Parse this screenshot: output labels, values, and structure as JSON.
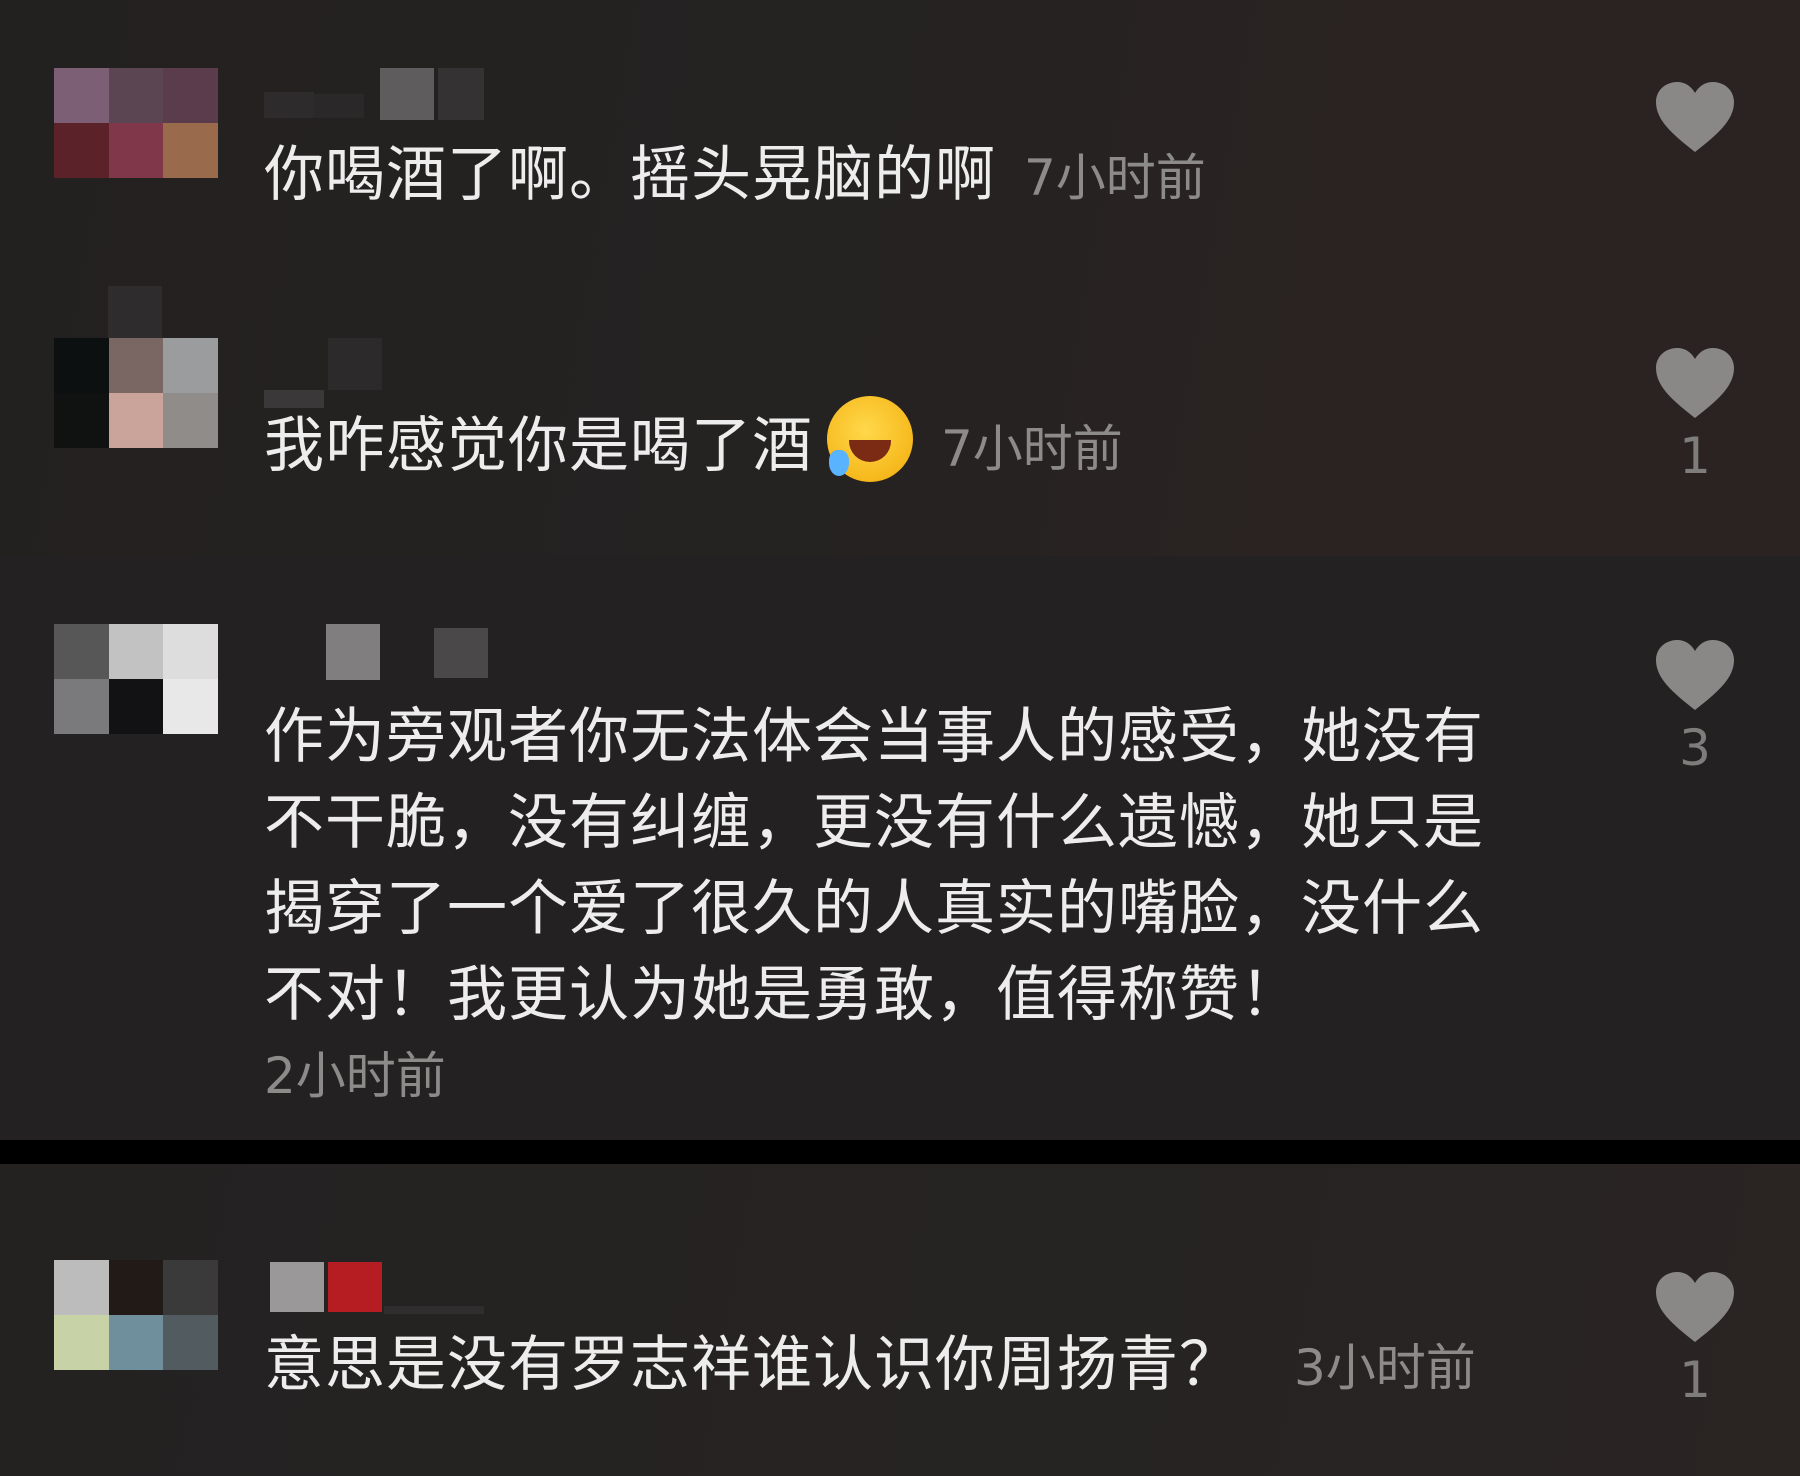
{
  "colors": {
    "background": "#232121",
    "text": "#ededed",
    "timestamp": "#8d8b8a",
    "like_icon": "#8a8887"
  },
  "comments": [
    {
      "text": "你喝酒了啊。摇头晃脑的啊",
      "time": "7小时前",
      "likes": "",
      "avatar_icon": "pixelated-avatar",
      "like_icon": "heart-icon"
    },
    {
      "text": "我咋感觉你是喝了酒",
      "emoji": "laughing-crying-emoji",
      "time": "7小时前",
      "likes": "1",
      "avatar_icon": "pixelated-avatar",
      "like_icon": "heart-icon"
    },
    {
      "text_lines": [
        "作为旁观者你无法体会当事人的感受，她没有",
        "不干脆，没有纠缠，更没有什么遗憾，她只是",
        "揭穿了一个爱了很久的人真实的嘴脸，没什么",
        "不对！我更认为她是勇敢，值得称赞！"
      ],
      "time": "2小时前",
      "likes": "3",
      "avatar_icon": "pixelated-avatar",
      "like_icon": "heart-icon"
    },
    {
      "text": "意思是没有罗志祥谁认识你周扬青？",
      "time": "3小时前",
      "likes": "1",
      "avatar_icon": "pixelated-avatar",
      "like_icon": "heart-icon"
    }
  ]
}
